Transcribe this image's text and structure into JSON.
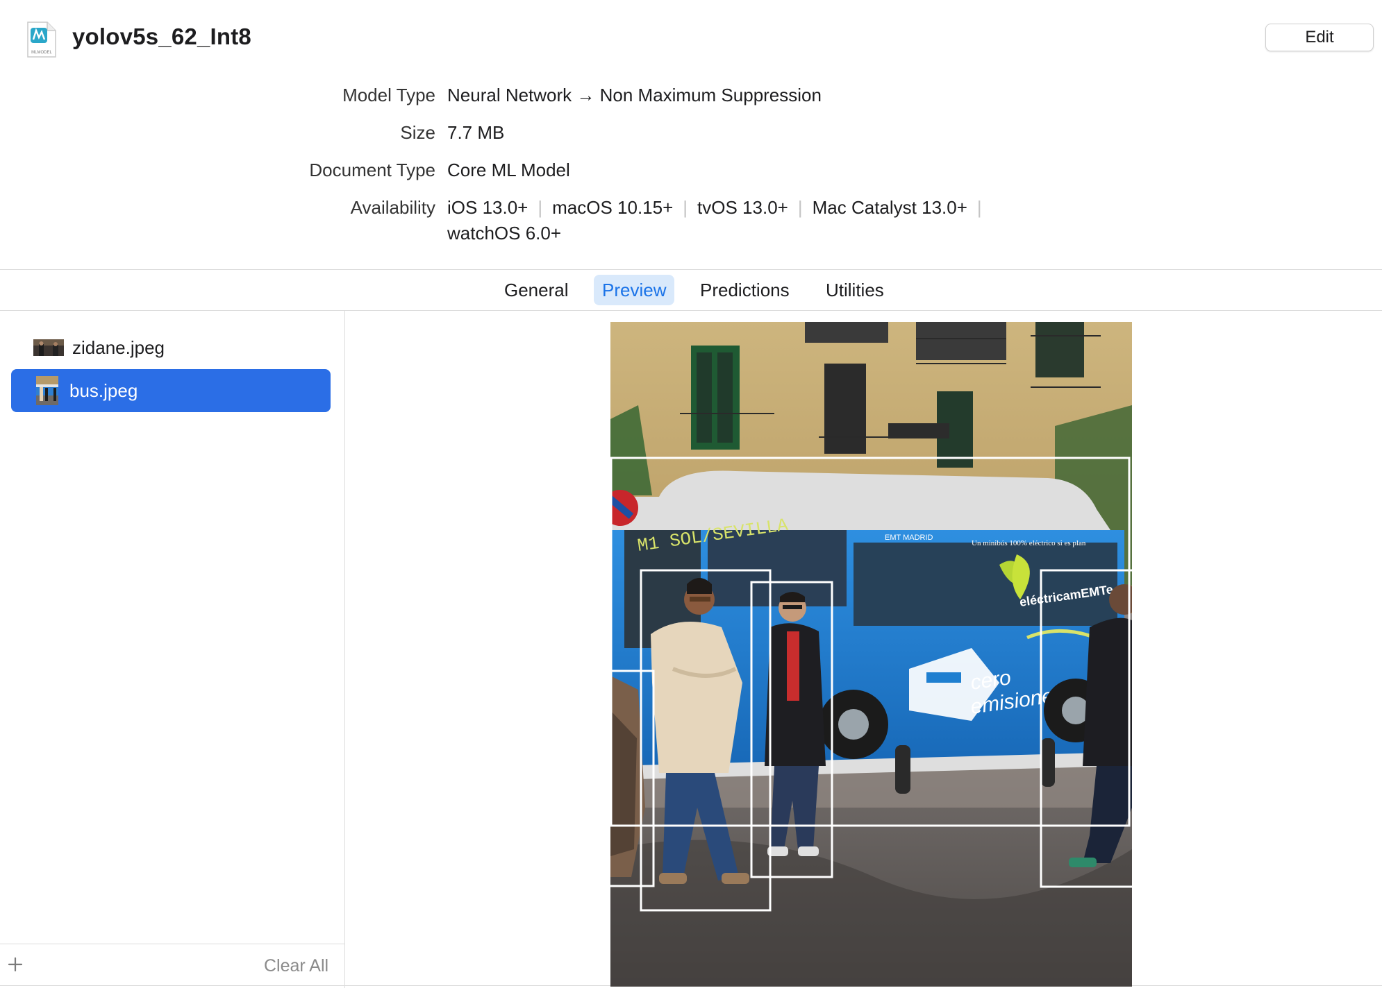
{
  "header": {
    "title": "yolov5s_62_Int8",
    "file_icon_caption": "MLMODEL",
    "edit_label": "Edit"
  },
  "info": {
    "model_type_label": "Model Type",
    "model_type_value": "Neural Network → Non Maximum Suppression",
    "size_label": "Size",
    "size_value": "7.7 MB",
    "document_type_label": "Document Type",
    "document_type_value": "Core ML Model",
    "availability_label": "Availability",
    "availability": [
      "iOS 13.0+",
      "macOS 10.15+",
      "tvOS 13.0+",
      "Mac Catalyst 13.0+",
      "watchOS 6.0+"
    ]
  },
  "tabs": [
    {
      "label": "General",
      "active": false
    },
    {
      "label": "Preview",
      "active": true
    },
    {
      "label": "Predictions",
      "active": false
    },
    {
      "label": "Utilities",
      "active": false
    }
  ],
  "sidebar": {
    "files": [
      {
        "name": "zidane.jpeg",
        "selected": false
      },
      {
        "name": "bus.jpeg",
        "selected": true
      }
    ],
    "add_icon": "plus-icon",
    "clear_all_label": "Clear All"
  },
  "preview": {
    "image": "bus.jpeg",
    "scene_text": {
      "route_sign": "M1 SOL/SEVILLA",
      "bus_brand": "eléctricamEMTe",
      "bus_slogan_1": "cero",
      "bus_slogan_2": "emisiones",
      "bus_top_banner": "Un minibús 100% eléctrico si es plan",
      "emt_logo": "EMT MADRID"
    },
    "detections": [
      {
        "label": "bus"
      },
      {
        "label": "person"
      },
      {
        "label": "person"
      },
      {
        "label": "person"
      },
      {
        "label": "person"
      }
    ]
  },
  "colors": {
    "accent": "#2b6ee6",
    "tab_active_bg": "#d9e9fb",
    "tab_active_text": "#1a73e8",
    "bus_blue": "#1f7fd0",
    "box_stroke": "#ffffff"
  }
}
